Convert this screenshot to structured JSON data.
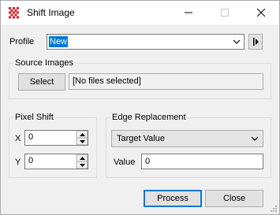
{
  "window": {
    "title": "Shift Image",
    "icon": "grid-app-icon",
    "controls": [
      "minimize-icon",
      "maximize-icon",
      "close-icon"
    ]
  },
  "profile": {
    "label": "Profile",
    "value": "New",
    "side_button_icon": "play-icon"
  },
  "source_images": {
    "group_title": "Source Images",
    "select_label": "Select",
    "files_value": "[No files selected]"
  },
  "pixel_shift": {
    "group_title": "Pixel Shift",
    "x_label": "X",
    "x_value": "0",
    "y_label": "Y",
    "y_value": "0"
  },
  "edge_replacement": {
    "group_title": "Edge Replacement",
    "mode_value": "Target Value",
    "value_label": "Value",
    "value": "0"
  },
  "actions": {
    "process_label": "Process",
    "close_label": "Close"
  },
  "colors": {
    "accent": "#0078d7",
    "background": "#f0f0f0",
    "titlebar": "#ffffff"
  }
}
